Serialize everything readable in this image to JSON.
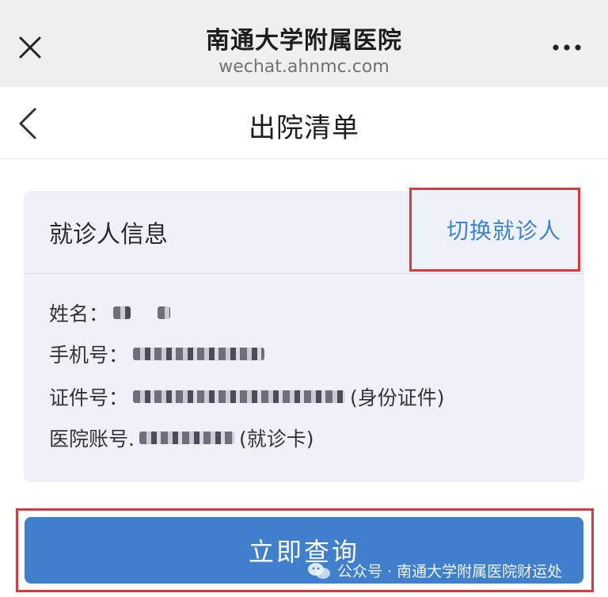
{
  "top_bar": {
    "title": "南通大学附属医院",
    "domain": "wechat.ahnmc.com",
    "close_icon": "close-icon",
    "more_icon": "more-icon"
  },
  "nav": {
    "title": "出院清单",
    "back_icon": "chevron-left-icon"
  },
  "card": {
    "title": "就诊人信息",
    "switch_label": "切换就诊人",
    "fields": [
      {
        "label": "姓名：",
        "value": "",
        "suffix": ""
      },
      {
        "label": "手机号：",
        "value": "",
        "suffix": ""
      },
      {
        "label": "证件号：",
        "value": "",
        "suffix": "(身份证件)"
      },
      {
        "label": "医院账号.",
        "value": "",
        "suffix": "(就诊卡)"
      }
    ]
  },
  "actions": {
    "query_label": "立即查询"
  },
  "watermark": {
    "text": "公众号 · 南通大学附属医院财运处",
    "icon": "wechat-icon"
  },
  "colors": {
    "accent": "#3b84cf",
    "button": "#3f7fcb",
    "highlight": "#d93a3f",
    "card_bg": "#eef2f8"
  }
}
